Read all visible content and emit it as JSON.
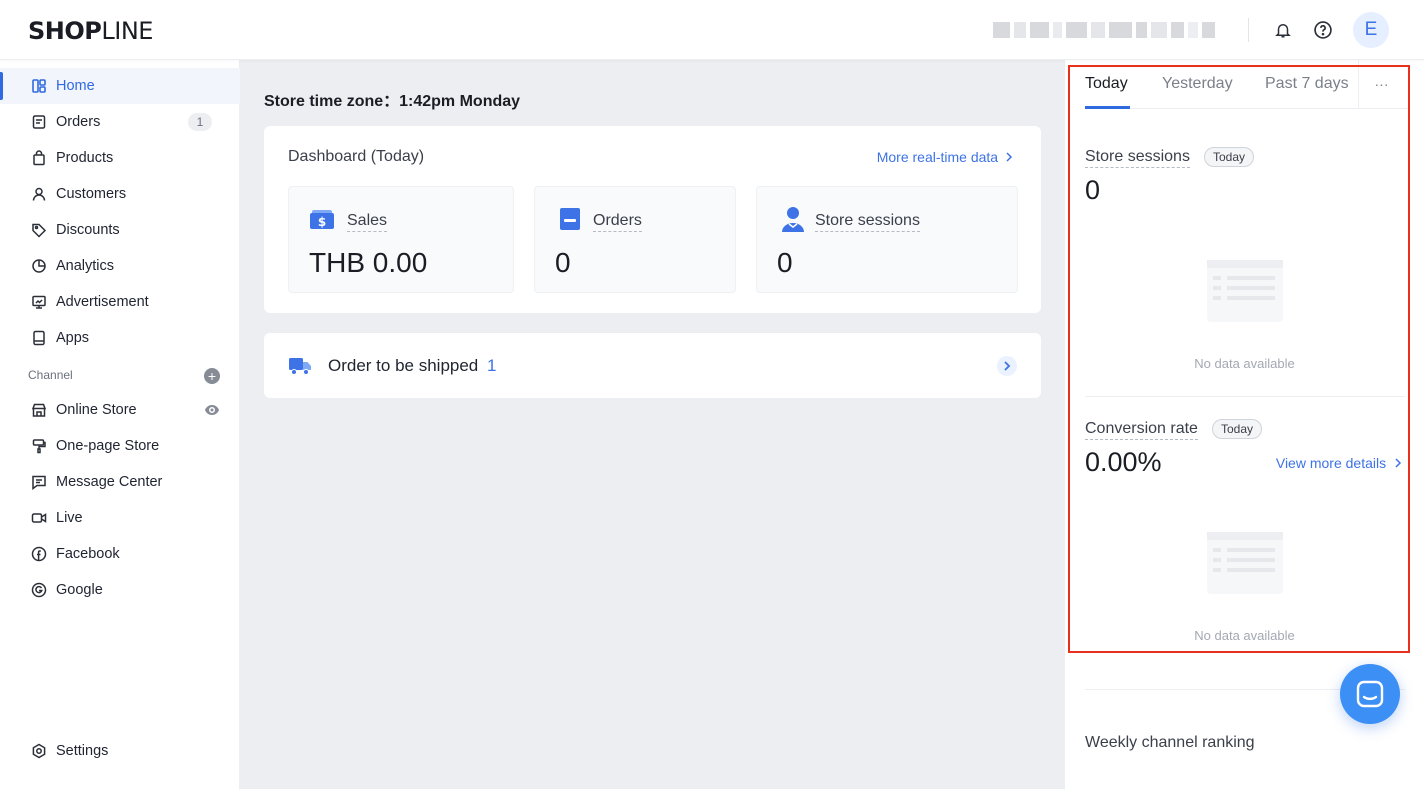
{
  "header": {
    "logo_bold": "SHOP",
    "logo_light": "LINE",
    "avatar_initial": "E",
    "icons": [
      "bell-icon",
      "help-icon"
    ]
  },
  "sidebar": {
    "items": [
      {
        "label": "Home",
        "icon": "home-icon"
      },
      {
        "label": "Orders",
        "icon": "orders-icon",
        "badge": "1"
      },
      {
        "label": "Products",
        "icon": "bag-icon"
      },
      {
        "label": "Customers",
        "icon": "person-icon"
      },
      {
        "label": "Discounts",
        "icon": "tag-icon"
      },
      {
        "label": "Analytics",
        "icon": "pie-icon"
      },
      {
        "label": "Advertisement",
        "icon": "monitor-icon"
      },
      {
        "label": "Apps",
        "icon": "apps-icon"
      }
    ],
    "channel_label": "Channel",
    "channel_add": "+",
    "channels": [
      {
        "label": "Online Store",
        "icon": "store-icon"
      },
      {
        "label": "One-page Store",
        "icon": "brush-icon"
      },
      {
        "label": "Message Center",
        "icon": "message-icon"
      },
      {
        "label": "Live",
        "icon": "video-icon"
      },
      {
        "label": "Facebook",
        "icon": "facebook-icon"
      },
      {
        "label": "Google",
        "icon": "google-icon"
      }
    ],
    "settings": "Settings"
  },
  "main": {
    "timezone": "Store time zone：1:42pm Monday",
    "dashboard_title": "Dashboard (Today)",
    "more_realtime": "More real-time data",
    "metrics": [
      {
        "label": "Sales",
        "value": "THB 0.00"
      },
      {
        "label": "Orders",
        "value": "0"
      },
      {
        "label": "Store sessions",
        "value": "0"
      }
    ],
    "ship_label": "Order to be shipped",
    "ship_count": "1"
  },
  "panel": {
    "tabs": [
      "Today",
      "Yesterday",
      "Past 7 days"
    ],
    "more": "···",
    "sessions_title": "Store sessions",
    "sessions_pill": "Today",
    "sessions_value": "0",
    "no_data": "No data available",
    "conv_title": "Conversion rate",
    "conv_pill": "Today",
    "conv_value": "0.00%",
    "view_more": "View more details",
    "weekly": "Weekly channel ranking"
  },
  "colors": {
    "accent": "#2f6ae0",
    "highlight": "#e8301c",
    "chat": "#3b8ff5"
  }
}
